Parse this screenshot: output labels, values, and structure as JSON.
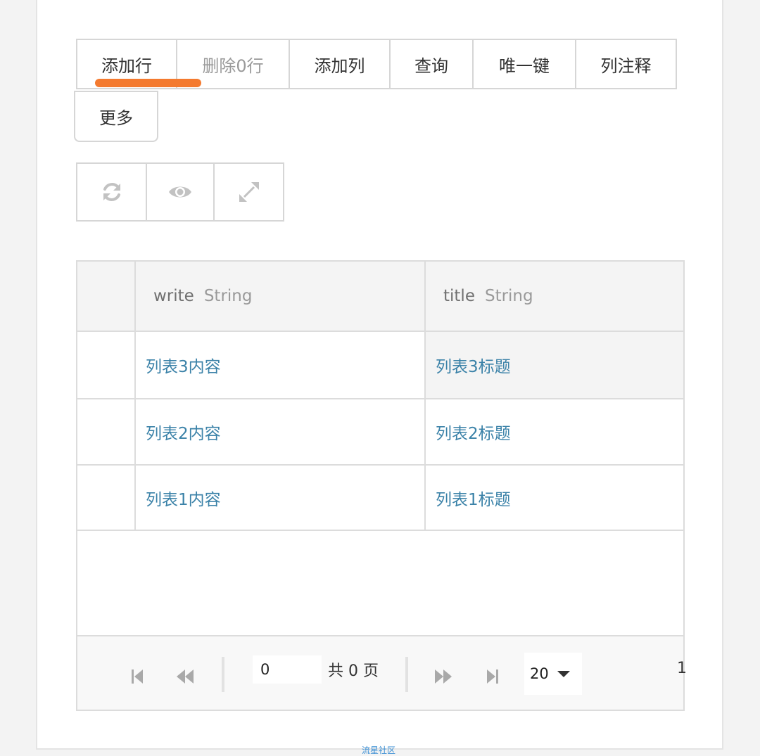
{
  "toolbar": {
    "add_row": "添加行",
    "delete_rows": "删除0行",
    "add_column": "添加列",
    "query": "查询",
    "unique_key": "唯一键",
    "column_comment": "列注释",
    "more": "更多"
  },
  "view_tools": [
    {
      "icon": "refresh-icon"
    },
    {
      "icon": "eye-icon"
    },
    {
      "icon": "expand-icon"
    }
  ],
  "grid": {
    "columns": [
      {
        "name": "write",
        "type": "String"
      },
      {
        "name": "title",
        "type": "String"
      }
    ],
    "rows": [
      {
        "write": "列表3内容",
        "title": "列表3标题"
      },
      {
        "write": "列表2内容",
        "title": "列表2标题"
      },
      {
        "write": "列表1内容",
        "title": "列表1标题"
      }
    ]
  },
  "pager": {
    "page_input": "0",
    "total_pages": "共 0 页",
    "page_size": "20",
    "range": "1"
  },
  "watermark": "流星社区",
  "colors": {
    "accent_underline": "#f47a2f",
    "cell_text": "#3b82a8",
    "border": "#d6d6d6"
  }
}
